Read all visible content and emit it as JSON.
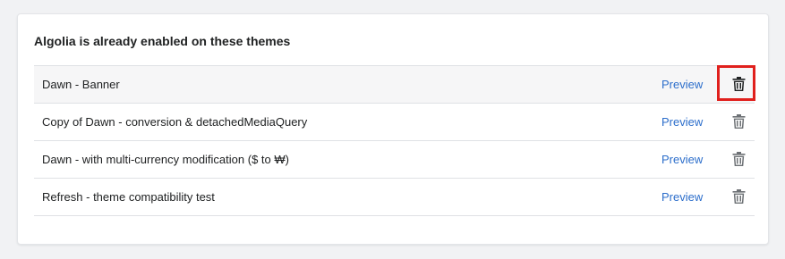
{
  "section": {
    "title": "Algolia is already enabled on these themes"
  },
  "themes": [
    {
      "name": "Dawn - Banner",
      "preview_label": "Preview",
      "highlighted": true
    },
    {
      "name": "Copy of Dawn - conversion & detachedMediaQuery",
      "preview_label": "Preview",
      "highlighted": false
    },
    {
      "name": "Dawn - with multi-currency modification ($ to ₩)",
      "preview_label": "Preview",
      "highlighted": false
    },
    {
      "name": "Refresh - theme compatibility test",
      "preview_label": "Preview",
      "highlighted": false
    }
  ],
  "icons": {
    "delete": "trash-icon"
  },
  "colors": {
    "link": "#2c6ecb",
    "highlight_border": "#e0201d",
    "icon_default": "#6d7175",
    "icon_active": "#202223"
  }
}
